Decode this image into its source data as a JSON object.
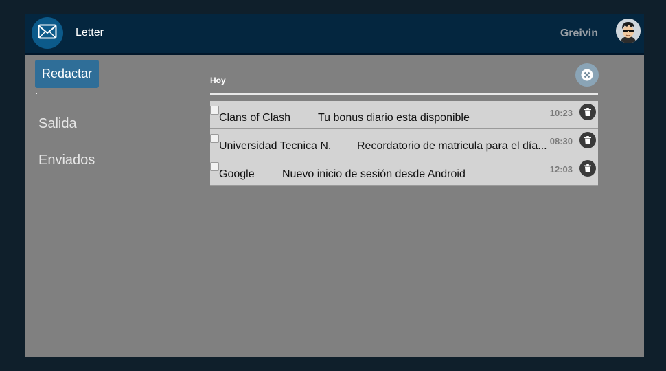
{
  "header": {
    "app_title": "Letter",
    "user_name": "Greivin",
    "logo_icon": "envelope-icon",
    "avatar_icon": "user-avatar-sunglasses"
  },
  "sidebar": {
    "compose_label": "Redactar",
    "items": [
      {
        "label": "Salida"
      },
      {
        "label": "Enviados"
      }
    ]
  },
  "main": {
    "section_label": "Hoy",
    "close_icon": "close-icon",
    "messages": [
      {
        "sender": "Clans of Clash",
        "subject": "Tu bonus diario esta disponible",
        "time": "10:23"
      },
      {
        "sender": "Universidad Tecnica N.",
        "subject": "Recordatorio de matricula para el día...",
        "time": "08:30"
      },
      {
        "sender": "Google",
        "subject": "Nuevo inicio de sesión desde Android",
        "time": "12:03"
      }
    ]
  },
  "colors": {
    "page_bg": "#0f1f2b",
    "topbar_bg": "#04263f",
    "content_bg": "#808080",
    "compose_bg": "#2f6e98",
    "row_bg": "#d3d3d3"
  }
}
